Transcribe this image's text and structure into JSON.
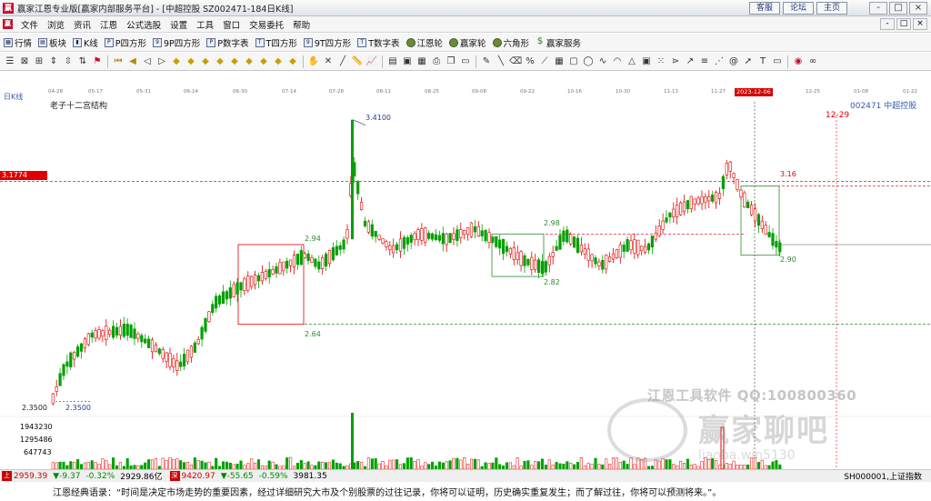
{
  "window": {
    "title": "赢家江恩专业版[赢家内部服务平台] - [中超控股  SZ002471-184日K线]",
    "links": [
      "客服",
      "论坛",
      "主页"
    ],
    "controls": [
      "-",
      "□",
      "×"
    ],
    "sub_controls": [
      "-",
      "□",
      "×"
    ]
  },
  "menu": [
    "文件",
    "浏览",
    "资讯",
    "江恩",
    "公式选股",
    "设置",
    "工具",
    "窗口",
    "交易委托",
    "帮助"
  ],
  "toolbar1": [
    {
      "icon": "grid-icon",
      "label": "行情"
    },
    {
      "icon": "blocks-icon",
      "label": "板块"
    },
    {
      "icon": "kline-icon",
      "label": "K线"
    },
    {
      "icon": "p-square-icon",
      "label": "P四方形"
    },
    {
      "icon": "9p-square-icon",
      "label": "9P四方形"
    },
    {
      "icon": "pn-square-icon",
      "label": "P数字表"
    },
    {
      "icon": "t-square-icon",
      "label": "T四方形"
    },
    {
      "icon": "9t-square-icon",
      "label": "9T四方形"
    },
    {
      "icon": "tn-square-icon",
      "label": "T数字表"
    },
    {
      "icon": "jiangen-wheel-icon",
      "label": "江恩轮"
    },
    {
      "icon": "winner-wheel-icon",
      "label": "赢家轮"
    },
    {
      "icon": "hexagon-icon",
      "label": "六角形"
    },
    {
      "icon": "dollar-icon",
      "label": "赢家服务"
    }
  ],
  "chart_header": {
    "period_label": "日K线",
    "structure_label": "老子十二宫结构",
    "stock_label": "002471  中超控股",
    "future_date": "12-29",
    "cursor_date": "2023-12-06"
  },
  "date_axis": [
    "04-28",
    "05-17",
    "05-31",
    "06-14",
    "06-30",
    "07-14",
    "07-28",
    "08-11",
    "08-25",
    "09-08",
    "09-22",
    "10-16",
    "10-30",
    "11-13",
    "11-27",
    "2023-12-06",
    "12-25",
    "01-08",
    "01-22"
  ],
  "price_labels": {
    "left_price": "3.1774",
    "low_left": "2.3500",
    "low_mark": "2.3500",
    "high_mark": "3.4100",
    "box1_top": "2.94",
    "box1_bottom": "2.64",
    "box2_top": "2.98",
    "box2_bottom": "2.82",
    "box3_top": "3.16",
    "box3_bottom": "2.90"
  },
  "volume_axis": [
    "1943230",
    "1295486",
    "647743"
  ],
  "watermark": {
    "line1": "江恩工具软件  QQ:100800360",
    "line2": "赢家聊吧",
    "line3": "liaoba.win5130"
  },
  "status": {
    "sh_index": "2959.39",
    "sh_change": "▼-9.37",
    "sh_pct": "-0.32%",
    "sh_amount": "2929.86亿",
    "sz_index": "9420.97",
    "sz_change": "▼-55.65",
    "sz_pct": "-0.59%",
    "sz_amount": "3981.35",
    "right_code": "SH000001,上证指数"
  },
  "quote": "江恩经典语录：“时间是决定市场走势的重要因素，经过详细研究大市及个别股票的过往记录，你将可以证明，历史确实重复发生；而了解过往，你将可以预测将来。”。",
  "chart_data": {
    "type": "candlestick",
    "title": "中超控股 002471 日K线",
    "x": [
      "04-28",
      "05-17",
      "05-31",
      "06-14",
      "06-30",
      "07-14",
      "07-28",
      "08-11",
      "08-25",
      "09-08",
      "09-22",
      "10-16",
      "10-30",
      "11-13",
      "11-27",
      "12-06"
    ],
    "close": [
      2.4,
      2.6,
      2.62,
      2.55,
      2.82,
      2.92,
      3.0,
      2.98,
      2.96,
      2.93,
      2.86,
      2.94,
      2.9,
      3.05,
      3.2,
      2.9
    ],
    "ylim": [
      2.3,
      3.45
    ],
    "levels": [
      2.35,
      2.64,
      2.82,
      2.9,
      2.94,
      2.98,
      3.16,
      3.1774,
      3.41
    ],
    "colors": {
      "up": "#e00000",
      "down": "#00a000",
      "level": "#2e8b2e",
      "red_level": "#e00000"
    }
  }
}
